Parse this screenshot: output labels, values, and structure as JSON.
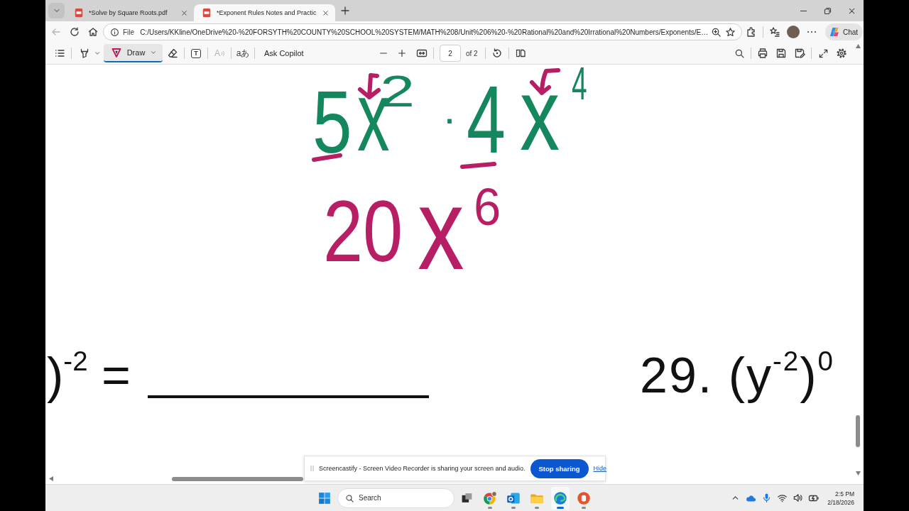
{
  "tab_strip": {
    "tabs": [
      {
        "title": "*Solve by Square Roots.pdf",
        "selected": false
      },
      {
        "title": "*Exponent Rules Notes and Practic",
        "selected": true
      }
    ]
  },
  "nav_buttons": [
    {
      "kind": "back",
      "disabled": true
    },
    {
      "kind": "refresh",
      "disabled": false
    },
    {
      "kind": "home",
      "disabled": false
    }
  ],
  "address_bar": {
    "scheme": "File",
    "url": "C:/Users/KKline/OneDrive%20-%20FORSYTH%20COUNTY%20SCHOOL%20SYSTEM/MATH%208/Unit%206%20-%20Rational%20and%20Irrational%20Numbers/Exponents/E…"
  },
  "copilot_chat": {
    "label": "Chat"
  },
  "pdf_toolbar": {
    "tools": [
      {
        "kind": "contents",
        "selected": false,
        "disabled": false
      },
      {
        "kind": "highlight",
        "selected": false,
        "disabled": false
      },
      {
        "kind": "draw",
        "label": "Draw",
        "selected": true,
        "disabled": false
      },
      {
        "kind": "erase",
        "selected": false,
        "disabled": false
      },
      {
        "kind": "text_box",
        "label": "T",
        "selected": false,
        "disabled": false
      },
      {
        "kind": "read_aloud",
        "label": "A",
        "selected": false,
        "disabled": true
      },
      {
        "kind": "translate",
        "label": "aあ",
        "selected": false,
        "disabled": false
      },
      {
        "kind": "copilot",
        "label": "Ask Copilot",
        "selected": false,
        "disabled": false
      }
    ],
    "page": "2",
    "page_count": "of 2"
  },
  "document": {
    "ink": [
      {
        "kind": "glyph",
        "text": "5",
        "color": "#14875c"
      },
      {
        "kind": "glyph",
        "text": "x",
        "color": "#14875c"
      },
      {
        "kind": "glyph",
        "text": "2",
        "color": "#14875c"
      },
      {
        "kind": "arrow",
        "color": "#b81e64"
      },
      {
        "kind": "underline",
        "color": "#b81e64"
      },
      {
        "kind": "glyph",
        "text": "·",
        "color": "#14875c"
      },
      {
        "kind": "glyph",
        "text": "4",
        "color": "#14875c"
      },
      {
        "kind": "glyph",
        "text": "x",
        "color": "#14875c"
      },
      {
        "kind": "glyph",
        "text": "4",
        "color": "#14875c"
      },
      {
        "kind": "arrow",
        "color": "#b81e64"
      },
      {
        "kind": "underline",
        "color": "#b81e64"
      },
      {
        "kind": "glyph",
        "text": "20",
        "color": "#b81e64"
      },
      {
        "kind": "glyph",
        "text": "x",
        "color": "#b81e64"
      },
      {
        "kind": "glyph",
        "text": "6",
        "color": "#b81e64"
      }
    ],
    "problems": [
      {
        "text": ")$^{-2}$ =",
        "blank": true
      },
      {
        "text": "29. (y$^{-2}$)$^{0}$"
      }
    ]
  },
  "notification": {
    "message": "Screencastify - Screen Video Recorder is sharing your screen and audio.",
    "button": "Stop sharing",
    "link": "Hide"
  },
  "taskbar": {
    "search_placeholder": "Search",
    "apps": [
      {
        "kind": "ring_browser",
        "active": false
      },
      {
        "kind": "mail",
        "active": false
      },
      {
        "kind": "folder",
        "active": false
      },
      {
        "kind": "wave_browser",
        "active": true
      },
      {
        "kind": "slides",
        "active": false
      }
    ],
    "clock": {
      "time": "2:5 PM",
      "date": "2/18/2026"
    }
  }
}
